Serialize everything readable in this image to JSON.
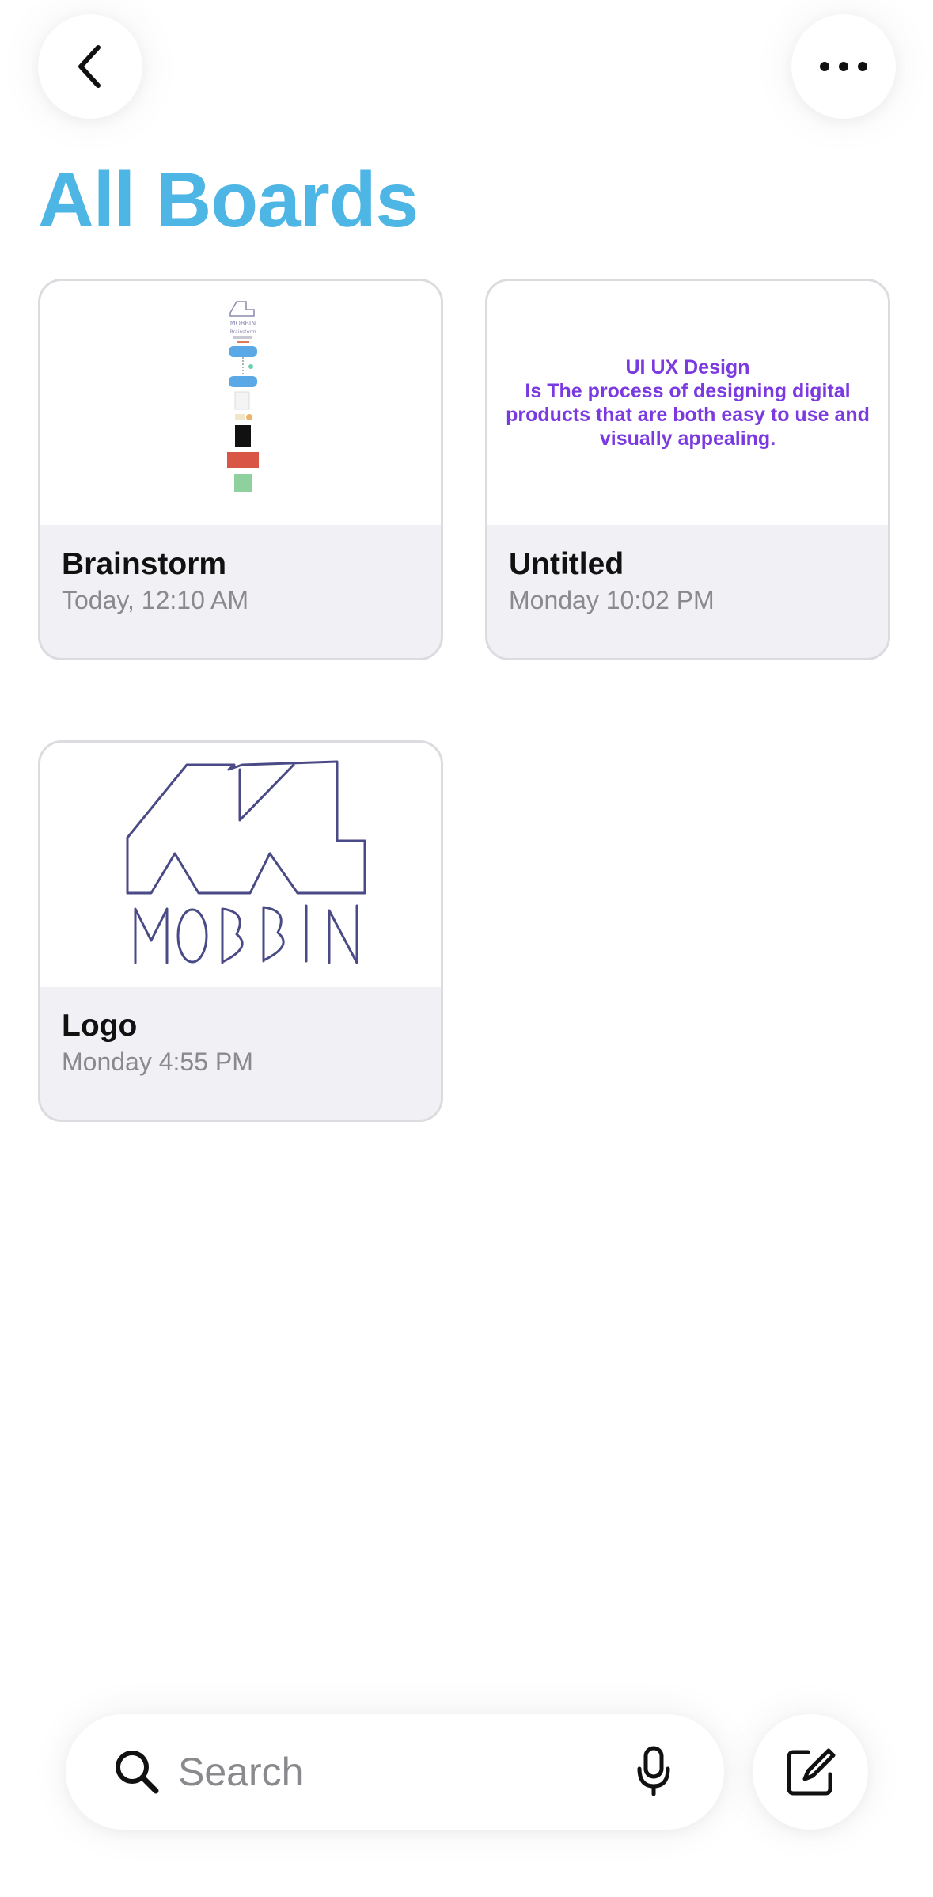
{
  "header": {
    "back_icon": "chevron-left-icon",
    "more_icon": "ellipsis-icon",
    "title": "All Boards"
  },
  "boards": [
    {
      "title": "Brainstorm",
      "date": "Today, 12:10 AM",
      "thumbnail": "mini-board-preview"
    },
    {
      "title": "Untitled",
      "date": "Monday 10:02 PM",
      "thumbnail": "text-preview",
      "preview_text": [
        "UI UX Design",
        "Is The process of designing digital",
        "products that are both easy to use and",
        "visually appealing."
      ]
    },
    {
      "title": "Logo",
      "date": "Monday 4:55 PM",
      "thumbnail": "handwritten-logo"
    }
  ],
  "search": {
    "placeholder": "Search",
    "search_icon": "magnifier-icon",
    "mic_icon": "microphone-icon"
  },
  "compose_icon": "compose-icon",
  "colors": {
    "title": "#4db6e4",
    "preview_text": "#7b3ae0",
    "card_footer": "#f1f1f5",
    "ink": "#4a4a86"
  }
}
